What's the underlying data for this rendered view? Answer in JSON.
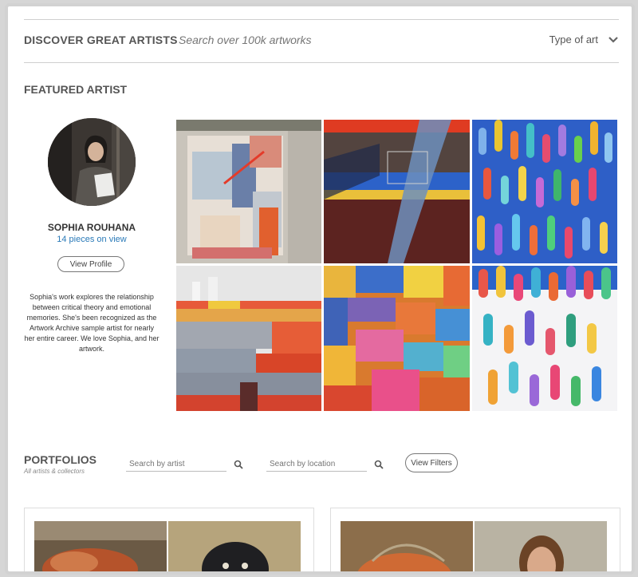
{
  "header": {
    "title": "DISCOVER GREAT ARTISTS",
    "search_placeholder": "Search over 100k artworks",
    "type_filter_label": "Type of art"
  },
  "featured": {
    "section_title": "FEATURED ARTIST",
    "artist_name": "SOPHIA ROUHANA",
    "pieces_text": "14 pieces on view",
    "view_profile_label": "View Profile",
    "bio": "Sophia's work explores the relationship between critical theory and emotional memories. She's been recognized as the Artwork Archive sample artist for nearly her entire career. We love Sophia, and her artwork."
  },
  "portfolios": {
    "section_title": "PORTFOLIOS",
    "subtitle": "All artists & collectors",
    "artist_search_placeholder": "Search by artist",
    "location_search_placeholder": "Search by location",
    "view_filters_label": "View Filters"
  },
  "colors": {
    "link": "#2a7ab8",
    "heading": "#555555",
    "rule": "#cfcfcf",
    "frame": "#d2d2d2"
  }
}
